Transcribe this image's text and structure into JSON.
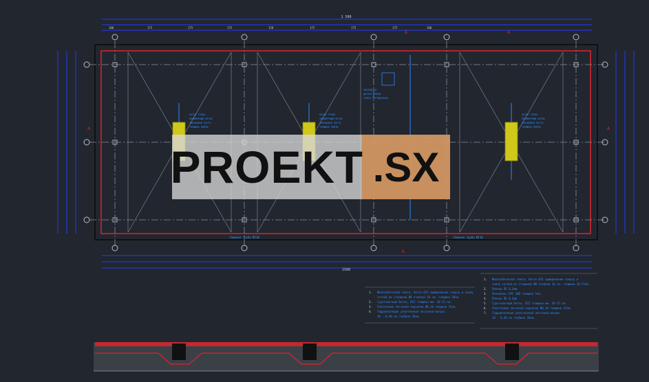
{
  "watermark": {
    "left": "PROEKT",
    "right": ".SX"
  },
  "dimensions": {
    "overall": "1 500",
    "top_row": [
      "100",
      "175",
      "175",
      "175",
      "150",
      "175",
      "175",
      "175",
      "100"
    ],
    "bottom_overall": "1500"
  },
  "annotations": {
    "bottom_label_left": "Сливная труба Ø110",
    "bottom_label_right": "Сливная труба Ø110"
  },
  "legend_left": [
    {
      "num": "1.",
      "text": "Железобетонная плита, бетон В25 армирование сверху и снизу"
    },
    {
      "num": "",
      "text": "сеткой из стержней Ø8 ячейкой 10 см. толщина 20см"
    },
    {
      "num": "2.",
      "text": "Грунтовочный бетон, В15 толщина мм. 50-15 см."
    },
    {
      "num": "3.",
      "text": "Уплотнение песчаной подсыпки Ø0,10 толщина 15см."
    },
    {
      "num": "4.",
      "text": "Гидроизоляция уплотненной песчаной матрас"
    },
    {
      "num": "",
      "text": "10 - 0,40 на глубине 20см."
    }
  ],
  "legend_right": [
    {
      "num": "1.",
      "text": "Железобетонная плита, бетон В25 армирование сверху и"
    },
    {
      "num": "",
      "text": "снизу сеткой из стержней Ø8 ячейкой 10 см. толщина 20-25см"
    },
    {
      "num": "2.",
      "text": "Пленка ПЕ 0,2мм"
    },
    {
      "num": "3.",
      "text": "Пеноплекс ЕРС 300 толщина 5см."
    },
    {
      "num": "4.",
      "text": "Пленка ПЕ 0,2мм"
    },
    {
      "num": "5.",
      "text": "Грунтовочный бетон, В15 толщина мм. 50-15 см."
    },
    {
      "num": "6.",
      "text": "Уплотнение песчаной подсыпки Ø0,10 толщина 15см."
    },
    {
      "num": "7.",
      "text": "Гидроизоляция уплотненной песчаной матрас"
    },
    {
      "num": "",
      "text": "10 - 0,40 на глубине 20см."
    }
  ],
  "colors": {
    "bg": "#22262f",
    "red": "#e0242a",
    "blue": "#1e38ff",
    "grey": "#9aa0aa",
    "yellow": "#d8d21a"
  }
}
